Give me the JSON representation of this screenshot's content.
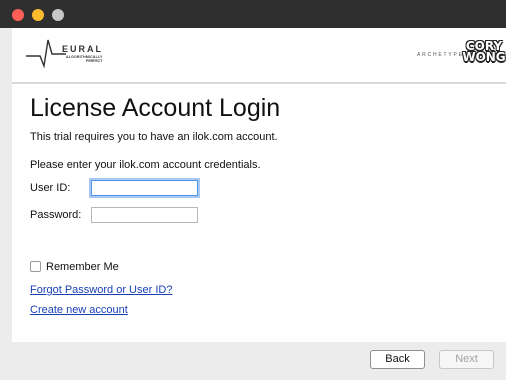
{
  "window": {
    "traffic_lights": [
      "close",
      "minimize",
      "zoom"
    ]
  },
  "header": {
    "brand_name": "EURAL",
    "brand_tagline_1": "ALGORITHMICALLY",
    "brand_tagline_2": "PERFECT",
    "product_name": "ARCHETYPE",
    "artist_logo_line1": "CORY",
    "artist_logo_line2": "WONG"
  },
  "page": {
    "title": "License Account Login",
    "intro": "This trial requires you to have an ilok.com account.",
    "instruction": "Please enter your ilok.com account credentials."
  },
  "form": {
    "user_id_label": "User ID:",
    "user_id_value": "",
    "password_label": "Password:",
    "password_value": "",
    "remember_label": "Remember Me",
    "remember_checked": false
  },
  "links": {
    "forgot": "Forgot Password or User ID?",
    "create": "Create new account"
  },
  "footer": {
    "back_label": "Back",
    "next_label": "Next"
  },
  "colors": {
    "link": "#1a40b5",
    "focus_ring": "#4f96e8",
    "titlebar": "#2f2f30"
  }
}
